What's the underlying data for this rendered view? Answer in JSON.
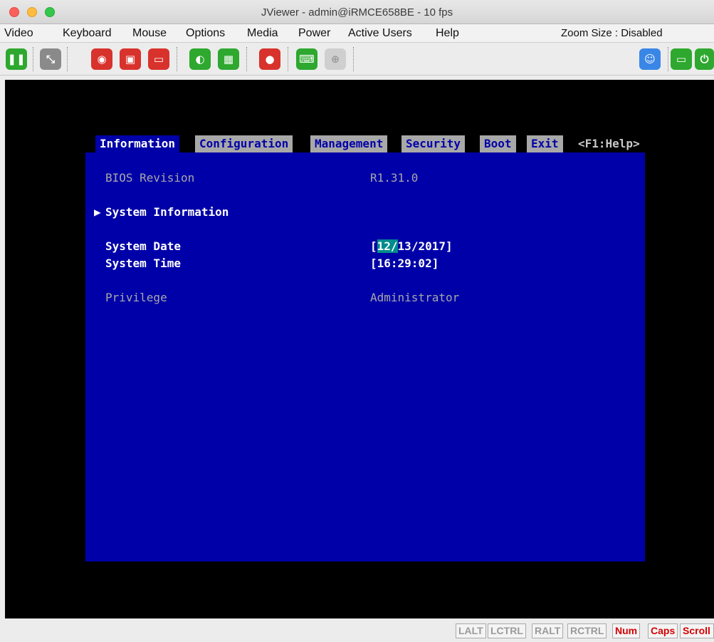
{
  "window": {
    "title": "JViewer - admin@iRMCE658BE - 10 fps"
  },
  "menu": {
    "items": [
      "Video",
      "Keyboard",
      "Mouse",
      "Options",
      "Media",
      "Power",
      "Active Users",
      "Help"
    ],
    "zoom_label": "Zoom Size : Disabled"
  },
  "toolbar": {
    "buttons": [
      "pause-icon",
      "fullscreen-icon",
      "cd-icon",
      "floppy-icon",
      "harddisk-icon",
      "mouse-icon",
      "keyboard-icon",
      "record-icon",
      "soft-keyboard-icon",
      "zoom-icon",
      "users-icon",
      "host-display-icon",
      "power-icon"
    ],
    "colors": {
      "red": "#d8322c",
      "green": "#2ea82e",
      "gray": "#8a8a8a",
      "blue": "#3a86e6"
    }
  },
  "bios": {
    "tabs": [
      "Information",
      "Configuration",
      "Management",
      "Security",
      "Boot",
      "Exit",
      "<F1:Help>"
    ],
    "active_tab": "Information",
    "bios_revision_label": "BIOS Revision",
    "bios_revision_value": "R1.31.0",
    "system_information": "System Information",
    "system_date_label": "System Date",
    "system_date_open": "[",
    "system_date_highlight": "12/",
    "system_date_rest": "13/2017]",
    "system_time_label": "System Time",
    "system_time_value": "[16:29:02]",
    "privilege_label": "Privilege",
    "privilege_value": "Administrator",
    "colors": {
      "background": "#0000a8",
      "highlight": "#008c8c"
    }
  },
  "statusbar": {
    "keys": [
      {
        "label": "LALT",
        "on": false
      },
      {
        "label": "LCTRL",
        "on": false
      },
      {
        "label": "RALT",
        "on": false
      },
      {
        "label": "RCTRL",
        "on": false
      },
      {
        "label": "Num",
        "on": true
      },
      {
        "label": "Caps",
        "on": true
      },
      {
        "label": "Scroll",
        "on": true
      }
    ]
  }
}
